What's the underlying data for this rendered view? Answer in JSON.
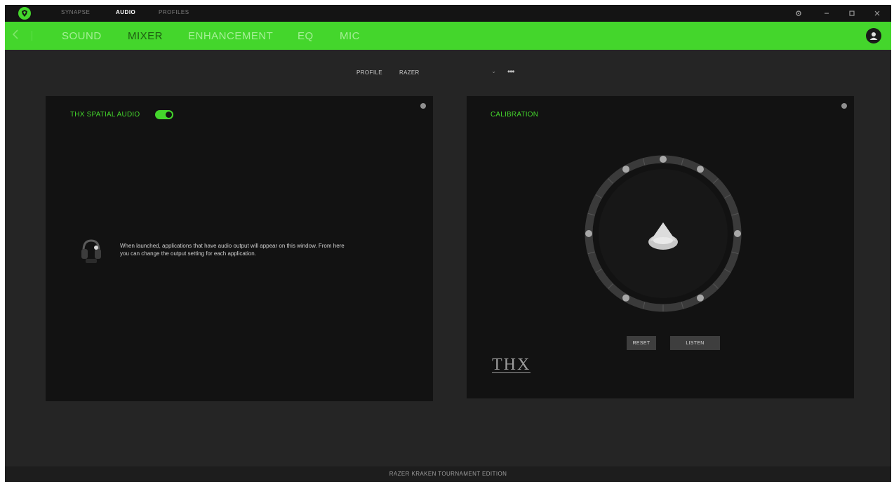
{
  "colors": {
    "accent": "#44d62c",
    "background": "#252525",
    "panel": "#121212",
    "titlebar": "#141414"
  },
  "titlebar": {
    "logo_icon": "razer-logo-icon",
    "tabs": [
      {
        "label": "SYNAPSE",
        "active": false
      },
      {
        "label": "AUDIO",
        "active": true
      },
      {
        "label": "PROFILES",
        "active": false
      }
    ],
    "window_controls": [
      "settings-icon",
      "minimize-icon",
      "maximize-icon",
      "close-icon"
    ]
  },
  "subnav": {
    "back_icon": "chevron-left-icon",
    "tabs": [
      {
        "label": "SOUND",
        "active": false
      },
      {
        "label": "MIXER",
        "active": true
      },
      {
        "label": "ENHANCEMENT",
        "active": false
      },
      {
        "label": "EQ",
        "active": false
      },
      {
        "label": "MIC",
        "active": false
      }
    ],
    "avatar_icon": "user-avatar-icon"
  },
  "profile": {
    "label": "PROFILE",
    "value": "RAZER",
    "more": "•••"
  },
  "spatial_audio": {
    "title": "THX SPATIAL AUDIO",
    "enabled": true,
    "message": "When launched, applications that have audio output will appear on this window. From here you can change the output setting for each application."
  },
  "calibration": {
    "title": "CALIBRATION",
    "reset_label": "RESET",
    "listen_label": "LISTEN",
    "logo_text": "THX"
  },
  "footer": {
    "device": "RAZER KRAKEN TOURNAMENT EDITION"
  }
}
